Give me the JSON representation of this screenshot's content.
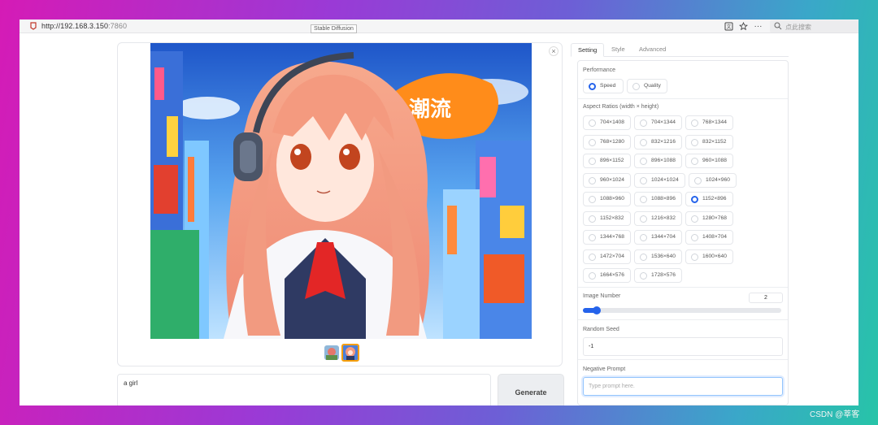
{
  "browser": {
    "url_host": "http://192.168.3.150",
    "url_port": ":7860",
    "tab_tooltip": "Stable Diffusion",
    "search_placeholder": "点此搜索",
    "icons": [
      "translate-icon",
      "star-icon",
      "more-icon",
      "search-icon"
    ]
  },
  "gallery": {
    "close_label": "×",
    "thumbnails": 2,
    "selected_thumbnail": 2
  },
  "prompt": {
    "value": "a girl"
  },
  "generate": {
    "label": "Generate"
  },
  "tabs": [
    {
      "label": "Setting",
      "active": true
    },
    {
      "label": "Style",
      "active": false
    },
    {
      "label": "Advanced",
      "active": false
    }
  ],
  "performance": {
    "label": "Performance",
    "options": [
      "Speed",
      "Quality"
    ],
    "selected": "Speed"
  },
  "aspect": {
    "label": "Aspect Ratios (width × height)",
    "options": [
      "704×1408",
      "704×1344",
      "768×1344",
      "768×1280",
      "832×1216",
      "832×1152",
      "896×1152",
      "896×1088",
      "960×1088",
      "960×1024",
      "1024×1024",
      "1024×960",
      "1088×960",
      "1088×896",
      "1152×896",
      "1152×832",
      "1216×832",
      "1280×768",
      "1344×768",
      "1344×704",
      "1408×704",
      "1472×704",
      "1536×640",
      "1600×640",
      "1664×576",
      "1728×576"
    ],
    "selected": "1152×896"
  },
  "image_number": {
    "label": "Image Number",
    "value": "2",
    "fraction": 0.05
  },
  "seed": {
    "label": "Random Seed",
    "value": "-1"
  },
  "negative": {
    "label": "Negative Prompt",
    "placeholder": "Type prompt here."
  },
  "watermark": "CSDN @莘客",
  "colors": {
    "accent": "#2563eb",
    "thumb_selected": "#f59e0b"
  }
}
